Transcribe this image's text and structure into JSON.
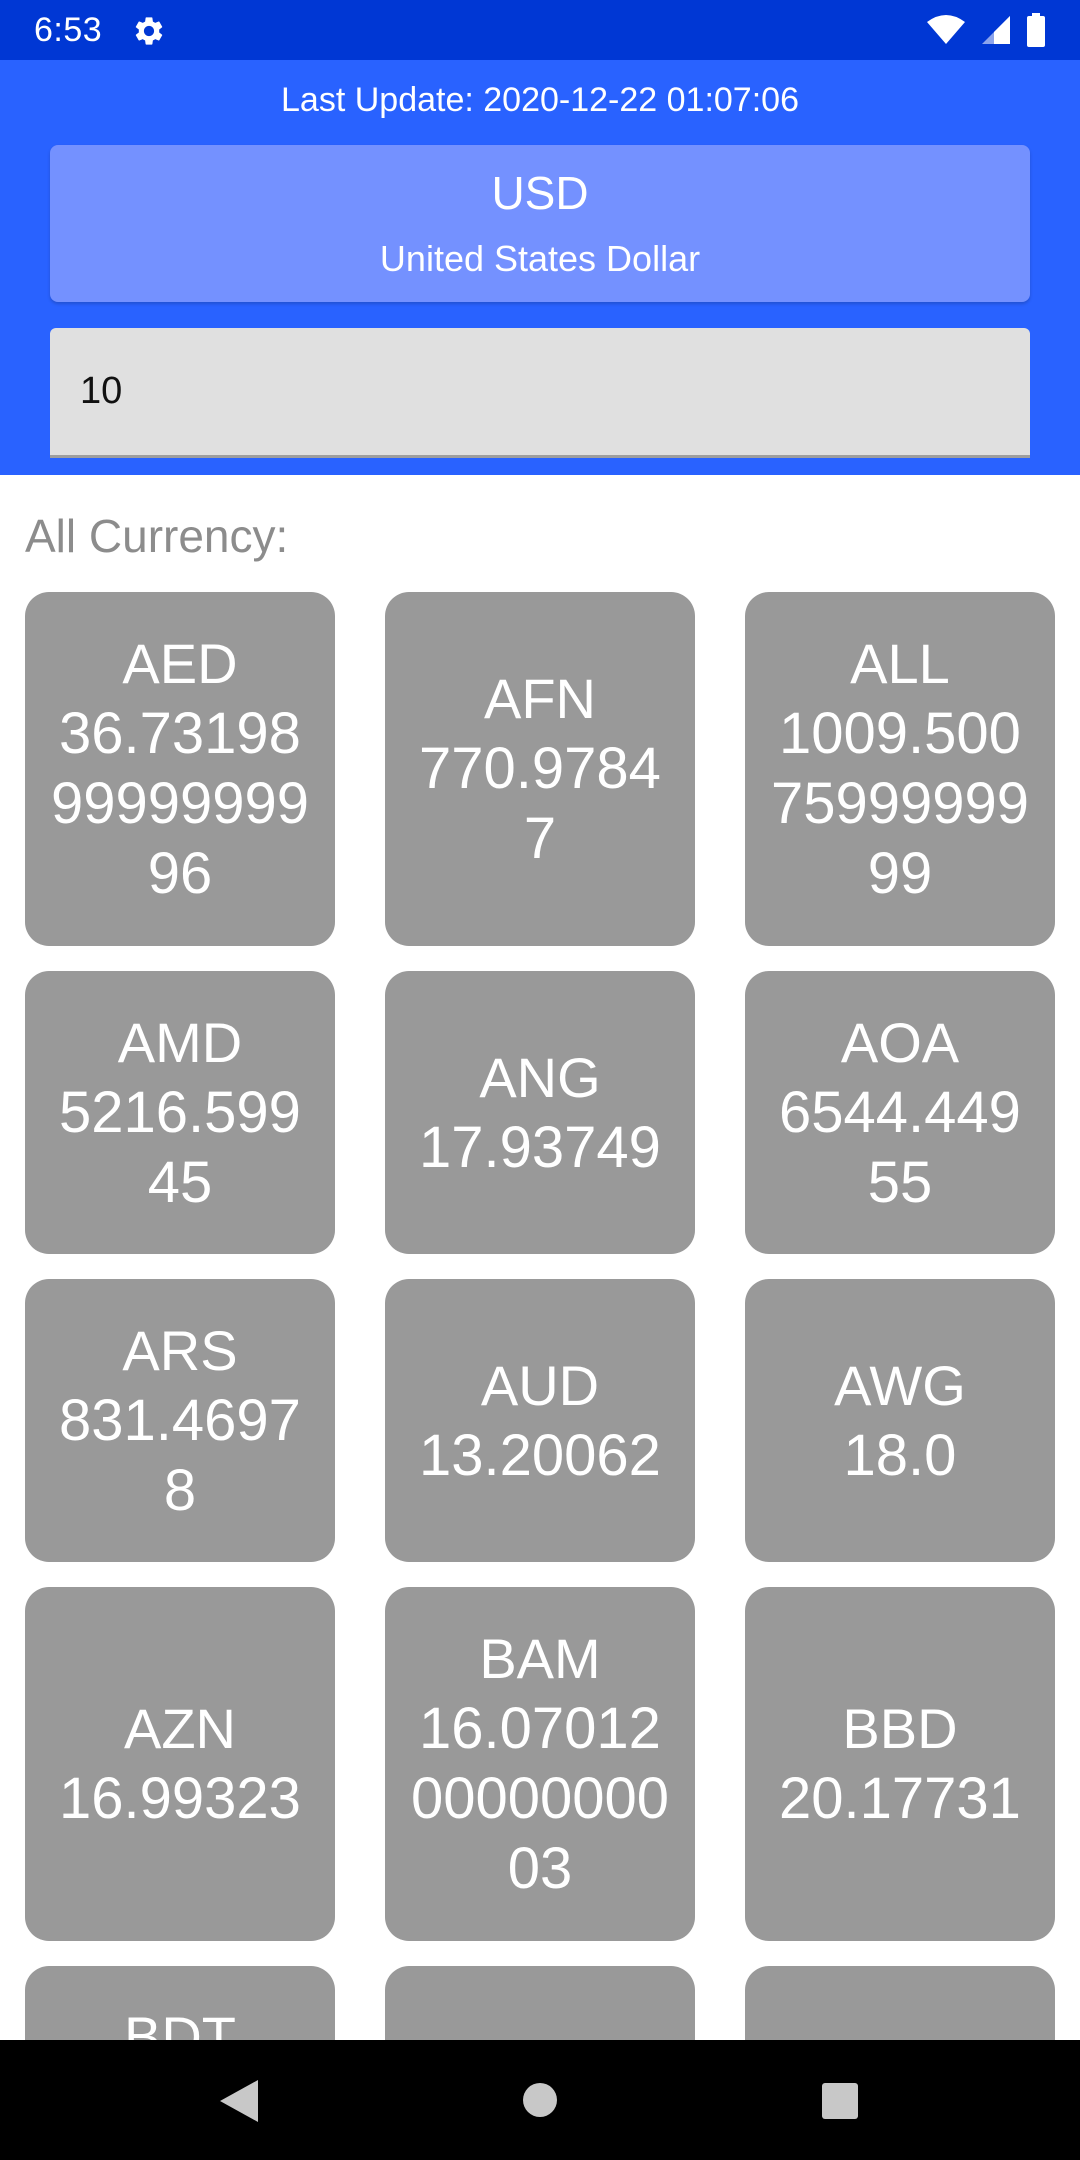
{
  "status_bar": {
    "time": "6:53",
    "icons": [
      "settings-gear-icon",
      "wifi-icon",
      "signal-icon",
      "battery-icon"
    ],
    "background_color": "#0037d4"
  },
  "header": {
    "last_update_label": "Last Update:",
    "last_update_value": "2020-12-22 01:07:06",
    "background_color": "#2962ff"
  },
  "base_currency": {
    "code": "USD",
    "name": "United States Dollar",
    "card_color": "#7491ff"
  },
  "amount_input": {
    "value": "10"
  },
  "section": {
    "label": "All Currency:"
  },
  "tile_color": "#999999",
  "currencies": [
    {
      "code": "AED",
      "value": "36.731989999999996"
    },
    {
      "code": "AFN",
      "value": "770.97847"
    },
    {
      "code": "ALL",
      "value": "1009.5007599999999"
    },
    {
      "code": "AMD",
      "value": "5216.59945"
    },
    {
      "code": "ANG",
      "value": "17.93749"
    },
    {
      "code": "AOA",
      "value": "6544.44955"
    },
    {
      "code": "ARS",
      "value": "831.46978"
    },
    {
      "code": "AUD",
      "value": "13.20062"
    },
    {
      "code": "AWG",
      "value": "18.0"
    },
    {
      "code": "AZN",
      "value": "16.99323"
    },
    {
      "code": "BAM",
      "value": "16.070120000000003"
    },
    {
      "code": "BBD",
      "value": "20.17731"
    },
    {
      "code": "BDT",
      "value": ""
    },
    {
      "code": "",
      "value": ""
    },
    {
      "code": "",
      "value": ""
    }
  ],
  "nav_bar": {
    "icons": [
      "back-icon",
      "home-icon",
      "recents-icon"
    ]
  }
}
